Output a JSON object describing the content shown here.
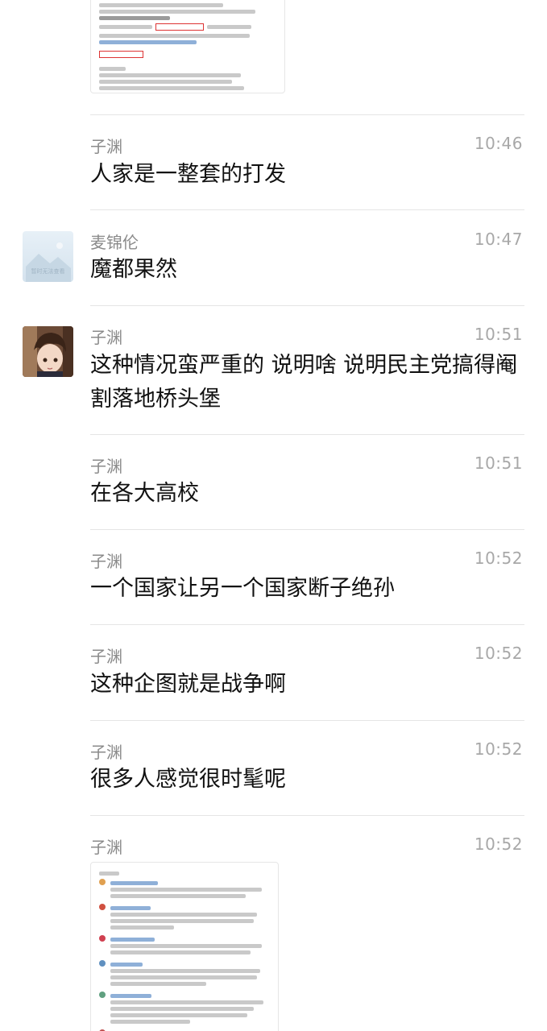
{
  "messages": [
    {
      "name": "子渊",
      "time": "10:46",
      "text": "人家是一整套的打发"
    },
    {
      "name": "麦锦伦",
      "time": "10:47",
      "text": "魔都果然"
    },
    {
      "name": "子渊",
      "time": "10:51",
      "text": "这种情况蛮严重的 说明啥 说明民主党搞得阉割落地桥头堡"
    },
    {
      "name": "子渊",
      "time": "10:51",
      "text": "在各大高校"
    },
    {
      "name": "子渊",
      "time": "10:52",
      "text": "一个国家让另一个国家断子绝孙"
    },
    {
      "name": "子渊",
      "time": "10:52",
      "text": "这种企图就是战争啊"
    },
    {
      "name": "子渊",
      "time": "10:52",
      "text": "很多人感觉很时髦呢"
    },
    {
      "name": "子渊",
      "time": "10:52",
      "text": ""
    }
  ],
  "placeholder_avatar_text": "暂时无法查看"
}
